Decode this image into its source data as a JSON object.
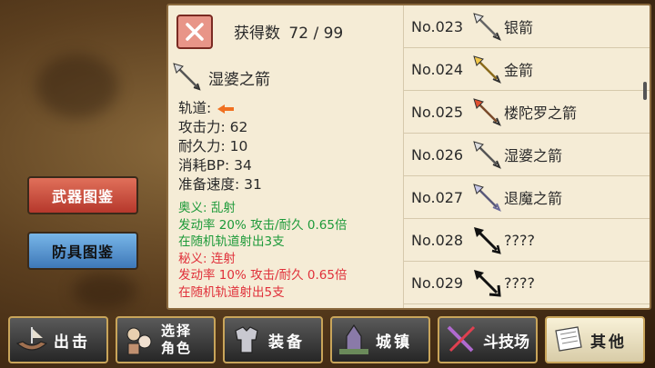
{
  "header": {
    "count_label": "获得数",
    "count_value": "72 / 99"
  },
  "detail": {
    "name": "湿婆之箭",
    "icon": "arrow-icon",
    "stats": {
      "trajectory_label": "轨道:",
      "attack": "攻击力: 62",
      "durability": "耐久力: 10",
      "bp_cost": "消耗BP: 34",
      "ready_speed": "准备速度: 31"
    },
    "skill1": {
      "title": "奥义: 乱射",
      "rate": "发动率 20%  攻击/耐久 0.65倍",
      "desc": "在随机轨道射出3支"
    },
    "skill2": {
      "title": "秘义: 连射",
      "rate": "发动率 10%    攻击/耐久 0.65倍",
      "desc": "在随机轨道射出5支"
    }
  },
  "list": [
    {
      "no": "No.023",
      "name": "银箭",
      "icon": "silver-arrow-icon"
    },
    {
      "no": "No.024",
      "name": "金箭",
      "icon": "gold-arrow-icon"
    },
    {
      "no": "No.025",
      "name": "楼陀罗之箭",
      "icon": "rudra-arrow-icon"
    },
    {
      "no": "No.026",
      "name": "湿婆之箭",
      "icon": "shiva-arrow-icon"
    },
    {
      "no": "No.027",
      "name": "退魔之箭",
      "icon": "exorcism-arrow-icon"
    },
    {
      "no": "No.028",
      "name": "????",
      "icon": "unknown-arrow-icon"
    },
    {
      "no": "No.029",
      "name": "????",
      "icon": "unknown-arrow-icon"
    }
  ],
  "side": {
    "weapon_book": "武器图鉴",
    "armor_book": "防具图鉴"
  },
  "nav": {
    "sortie": "出击",
    "select_line1": "选择",
    "select_line2": "角色",
    "equip": "装备",
    "town": "城镇",
    "arena": "斗技场",
    "other": "其他"
  },
  "colors": {
    "panel_bg": "#f5ecd6",
    "skill_green": "#1e9a3a",
    "skill_red": "#e0303a",
    "close_button": "#e89588",
    "active_tab": "#f8f1d8"
  }
}
